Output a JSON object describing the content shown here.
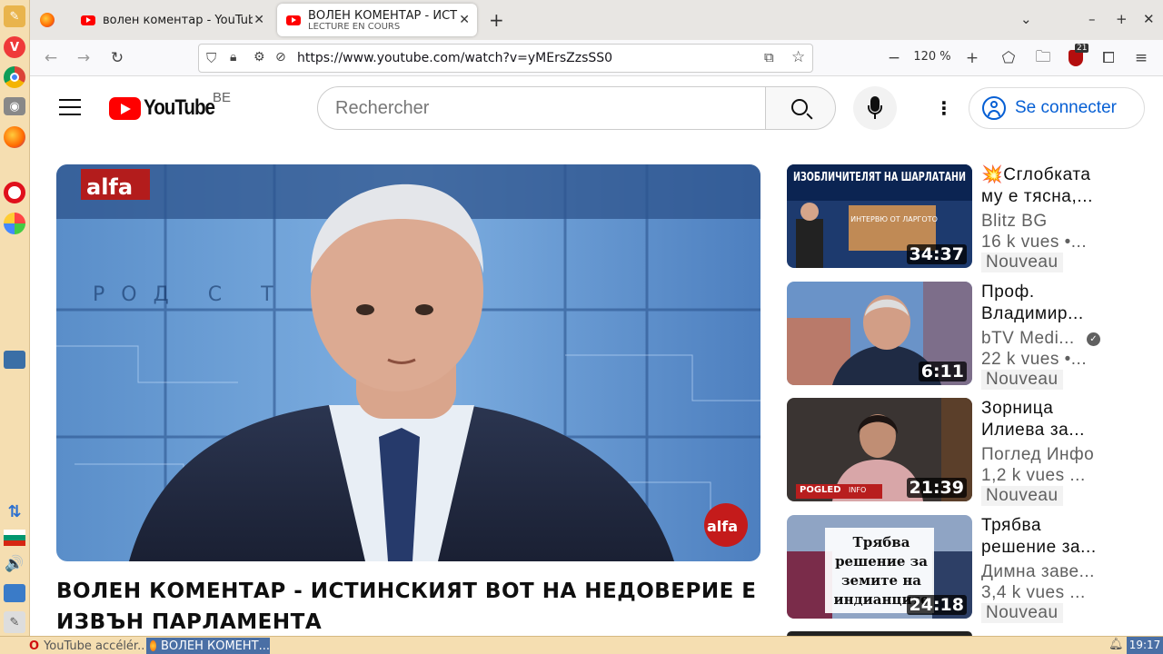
{
  "browser": {
    "tabs": [
      {
        "title": "волен коментар - YouTube"
      },
      {
        "title": "ВОЛЕН КОМЕНТАР - ИСТИНСКИЯТ",
        "subtitle": "LECTURE EN COURS"
      }
    ],
    "new_tab": "+",
    "url": "https://www.youtube.com/watch?v=yMErsZzsSS0",
    "zoom": "120 %",
    "zoom_minus": "−",
    "zoom_plus": "+",
    "extension_badge": "21"
  },
  "youtube": {
    "logo_text": "YouTube",
    "country": "BE",
    "search_placeholder": "Rechercher",
    "signin_label": "Se connecter"
  },
  "video": {
    "title": "ВОЛЕН КОМЕНТАР - ИСТИНСКИЯТ ВОТ НА НЕДОВЕРИЕ Е ИЗВЪН ПАРЛАМЕНТА",
    "channel_logo": "alfa",
    "backdrop_text": "РОД  С Т"
  },
  "recommendations": [
    {
      "title": "💥Сглобката му е тясна,...",
      "channel": "Blitz BG",
      "views": "16 k vues  •...",
      "badge": "Nouveau",
      "duration": "34:37",
      "thumb_text": "ИЗОБЛИЧИТЕЛЯТ НА ШАРЛАТАНИ",
      "thumb_sub": "ИНТЕРВЮ ОТ ЛАРГОТО"
    },
    {
      "title": "Проф. Владимир...",
      "channel": "bTV Medi...",
      "views": "22 k vues  •...",
      "badge": "Nouveau",
      "duration": "6:11"
    },
    {
      "title": "Зорница Илиева за...",
      "channel": "Поглед Инфо",
      "views": "1,2 k vues ...",
      "badge": "Nouveau",
      "duration": "21:39",
      "thumb_logo": "POGLED",
      "thumb_logo_sub": "INFO"
    },
    {
      "title": "Трябва решение за...",
      "channel": "Димна заве...",
      "views": "3,4 k vues ...",
      "badge": "Nouveau",
      "duration": "24:18",
      "thumb_text": "Трябва решение за земите на индианците"
    }
  ],
  "taskbar": {
    "items": [
      {
        "label": "YouTube accélér..."
      },
      {
        "label": "ВОЛЕН КОМЕНТ..."
      }
    ],
    "clock": "19:17"
  }
}
